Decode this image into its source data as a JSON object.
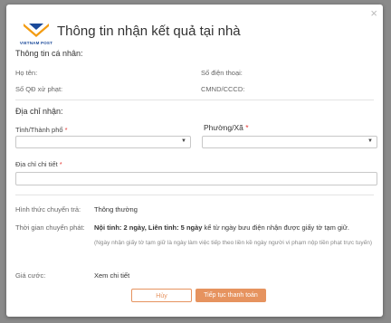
{
  "modal": {
    "title": "Thông tin nhận kết quả tại nhà",
    "close_symbol": "×",
    "logo": {
      "text": "VIETNAM POST",
      "icon": "vietnam-post-logo"
    }
  },
  "personal": {
    "heading": "Thông tin cá nhân:",
    "name_label": "Họ tên:",
    "phone_label": "Số điện thoại:",
    "decision_label": "Số QĐ xử phạt:",
    "id_label": "CMND/CCCD:"
  },
  "address": {
    "heading": "Địa chỉ nhận:",
    "province_label": "Tỉnh/Thành phố",
    "ward_label": "Phường/Xã",
    "required_mark": "*",
    "detail_label": "Địa chỉ chi tiết"
  },
  "delivery": {
    "method_label": "Hình thức chuyển trả:",
    "method_value": "Thông thường",
    "time_label": "Thời gian chuyển phát:",
    "time_bold": "Nội tỉnh: 2 ngày, Liên tỉnh: 5 ngày",
    "time_rest": " kể từ ngày bưu điện nhận được giấy tờ tạm giữ.",
    "time_note": "(Ngày nhận giấy tờ tạm giữ là ngày làm việc tiếp theo liền kề ngày người vi phạm nộp tiền phạt trực tuyến)",
    "fee_label": "Giá cước:",
    "fee_value": "Xem chi tiết"
  },
  "buttons": {
    "cancel": "Hủy",
    "next": "Tiếp tục thanh toán"
  },
  "colors": {
    "accent": "#e6935f",
    "logo_blue": "#1b4a9a",
    "logo_orange": "#f39c12",
    "required": "#e53935"
  }
}
